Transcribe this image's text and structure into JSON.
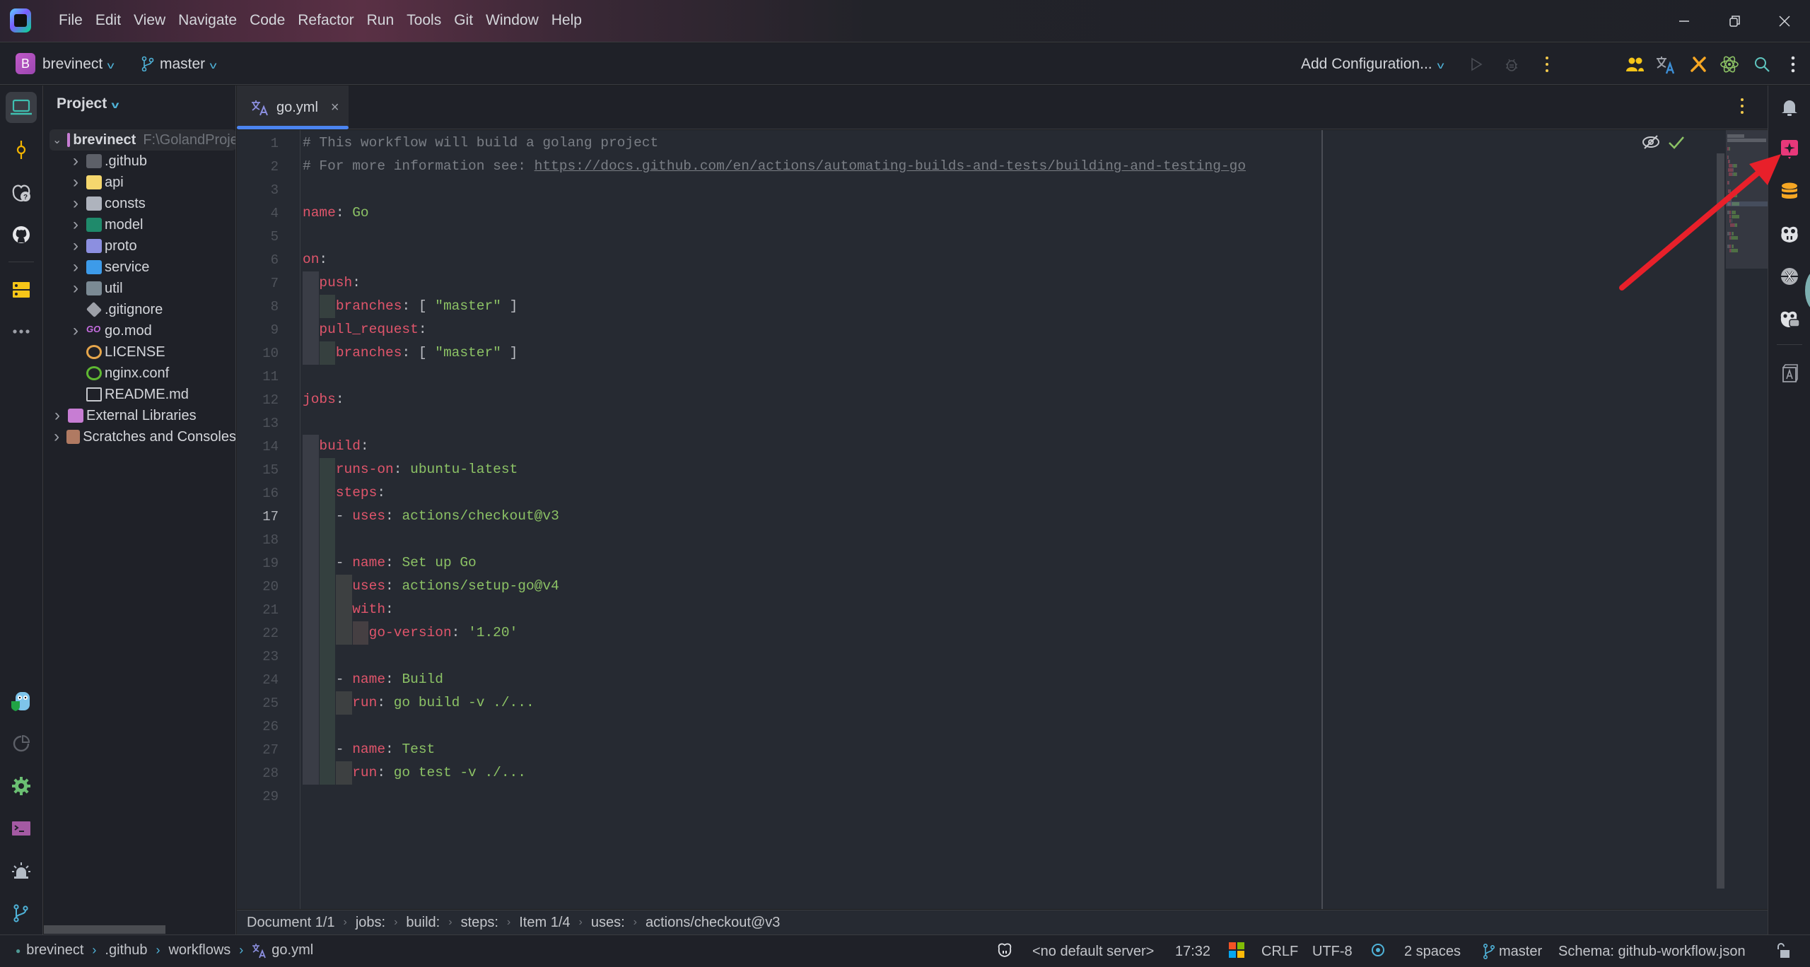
{
  "menu": [
    "File",
    "Edit",
    "View",
    "Navigate",
    "Code",
    "Refactor",
    "Run",
    "Tools",
    "Git",
    "Window",
    "Help"
  ],
  "window_controls": {
    "minimize": "—",
    "restore": "❐",
    "close": "✕"
  },
  "toolbar": {
    "project_badge": "B",
    "project_name": "brevinect",
    "branch": "master",
    "run_config": "Add Configuration..."
  },
  "project_panel": {
    "title": "Project",
    "root": {
      "name": "brevinect",
      "path": "F:\\GolandProjects"
    },
    "items": [
      {
        "name": ".github",
        "icon": "github-folder-icon",
        "expandable": true
      },
      {
        "name": "api",
        "icon": "api-folder-icon",
        "expandable": true
      },
      {
        "name": "consts",
        "icon": "folder-icon",
        "expandable": true
      },
      {
        "name": "model",
        "icon": "model-folder-icon",
        "expandable": true
      },
      {
        "name": "proto",
        "icon": "proto-folder-icon",
        "expandable": true
      },
      {
        "name": "service",
        "icon": "service-folder-icon",
        "expandable": true
      },
      {
        "name": "util",
        "icon": "util-folder-icon",
        "expandable": true
      },
      {
        "name": ".gitignore",
        "icon": "gitignore-icon",
        "expandable": false
      },
      {
        "name": "go.mod",
        "icon": "go-mod-icon",
        "expandable": true
      },
      {
        "name": "LICENSE",
        "icon": "license-icon",
        "expandable": false
      },
      {
        "name": "nginx.conf",
        "icon": "nginx-icon",
        "expandable": false
      },
      {
        "name": "README.md",
        "icon": "readme-icon",
        "expandable": false
      }
    ],
    "extra": [
      {
        "name": "External Libraries",
        "icon": "library-icon"
      },
      {
        "name": "Scratches and Consoles",
        "icon": "scratches-icon"
      }
    ]
  },
  "editor": {
    "tab": {
      "name": "go.yml",
      "close": "×"
    },
    "current_line": 17,
    "lines": [
      [
        [
          "comment",
          "# This workflow will build a golang project"
        ]
      ],
      [
        [
          "comment",
          "# For more information see: "
        ],
        [
          "link",
          "https://docs.github.com/en/actions/automating-builds-and-tests/building-and-testing-go"
        ]
      ],
      [],
      [
        [
          "key",
          "name"
        ],
        [
          "punc",
          ": "
        ],
        [
          "val",
          "Go"
        ]
      ],
      [],
      [
        [
          "key",
          "on"
        ],
        [
          "punc",
          ":"
        ]
      ],
      [
        [
          "punc",
          "  "
        ],
        [
          "key",
          "push"
        ],
        [
          "punc",
          ":"
        ]
      ],
      [
        [
          "punc",
          "    "
        ],
        [
          "key",
          "branches"
        ],
        [
          "punc",
          ": [ "
        ],
        [
          "val",
          "\"master\""
        ],
        [
          "punc",
          " ]"
        ]
      ],
      [
        [
          "punc",
          "  "
        ],
        [
          "key",
          "pull_request"
        ],
        [
          "punc",
          ":"
        ]
      ],
      [
        [
          "punc",
          "    "
        ],
        [
          "key",
          "branches"
        ],
        [
          "punc",
          ": [ "
        ],
        [
          "val",
          "\"master\""
        ],
        [
          "punc",
          " ]"
        ]
      ],
      [],
      [
        [
          "key",
          "jobs"
        ],
        [
          "punc",
          ":"
        ]
      ],
      [],
      [
        [
          "punc",
          "  "
        ],
        [
          "key",
          "build"
        ],
        [
          "punc",
          ":"
        ]
      ],
      [
        [
          "punc",
          "    "
        ],
        [
          "key",
          "runs-on"
        ],
        [
          "punc",
          ": "
        ],
        [
          "val",
          "ubuntu-latest"
        ]
      ],
      [
        [
          "punc",
          "    "
        ],
        [
          "key",
          "steps"
        ],
        [
          "punc",
          ":"
        ]
      ],
      [
        [
          "punc",
          "    - "
        ],
        [
          "key",
          "uses"
        ],
        [
          "punc",
          ": "
        ],
        [
          "val",
          "actions/checkout@v3"
        ]
      ],
      [],
      [
        [
          "punc",
          "    - "
        ],
        [
          "key",
          "name"
        ],
        [
          "punc",
          ": "
        ],
        [
          "val",
          "Set up Go"
        ]
      ],
      [
        [
          "punc",
          "      "
        ],
        [
          "key",
          "uses"
        ],
        [
          "punc",
          ": "
        ],
        [
          "val",
          "actions/setup-go@v4"
        ]
      ],
      [
        [
          "punc",
          "      "
        ],
        [
          "key",
          "with"
        ],
        [
          "punc",
          ":"
        ]
      ],
      [
        [
          "punc",
          "        "
        ],
        [
          "key",
          "go-version"
        ],
        [
          "punc",
          ": "
        ],
        [
          "val",
          "'1.20'"
        ]
      ],
      [],
      [
        [
          "punc",
          "    - "
        ],
        [
          "key",
          "name"
        ],
        [
          "punc",
          ": "
        ],
        [
          "val",
          "Build"
        ]
      ],
      [
        [
          "punc",
          "      "
        ],
        [
          "key",
          "run"
        ],
        [
          "punc",
          ": "
        ],
        [
          "val",
          "go build -v ./..."
        ]
      ],
      [],
      [
        [
          "punc",
          "    - "
        ],
        [
          "key",
          "name"
        ],
        [
          "punc",
          ": "
        ],
        [
          "val",
          "Test"
        ]
      ],
      [
        [
          "punc",
          "      "
        ],
        [
          "key",
          "run"
        ],
        [
          "punc",
          ": "
        ],
        [
          "val",
          "go test -v ./..."
        ]
      ],
      []
    ]
  },
  "editor_breadcrumb": [
    "Document 1/1",
    "jobs:",
    "build:",
    "steps:",
    "Item 1/4",
    "uses:",
    "actions/checkout@v3"
  ],
  "status_bar": {
    "path": [
      "brevinect",
      ".github",
      "workflows",
      "go.yml"
    ],
    "server": "<no default server>",
    "position": "17:32",
    "line_separator": "CRLF",
    "encoding": "UTF-8",
    "indent": "2 spaces",
    "branch": "master",
    "schema": "Schema: github-workflow.json"
  },
  "colors": {
    "accent": "#4b84f0",
    "annotation_arrow": "#e8202a",
    "yaml_key": "#e0556b",
    "yaml_value": "#8cc265"
  }
}
